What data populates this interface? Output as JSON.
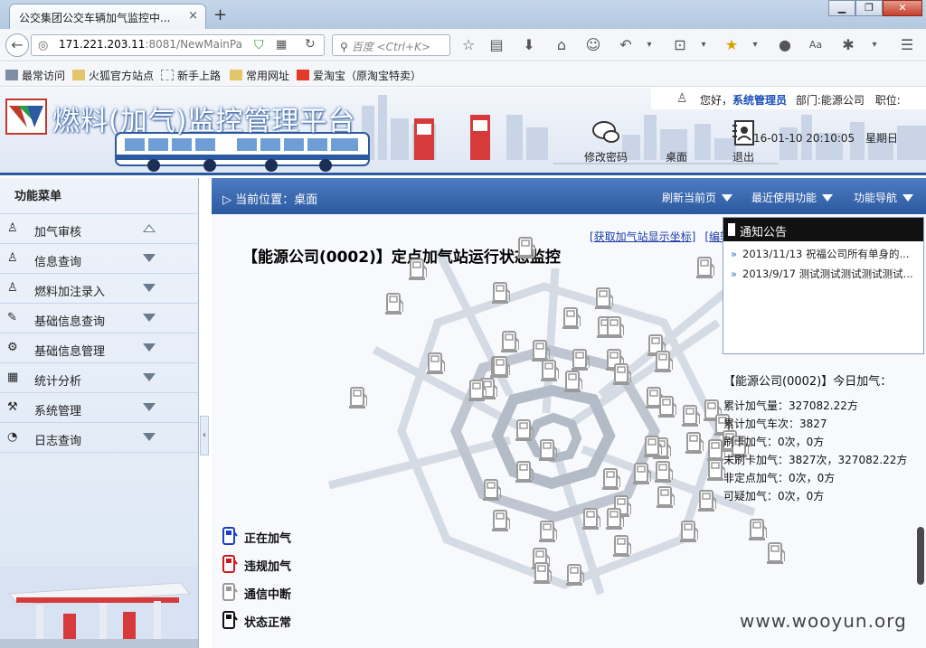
{
  "browser": {
    "tab_title": "公交集团公交车辆加气监控中...",
    "tab_close": "×",
    "new_tab": "+",
    "url_host": "171.221.203.11",
    "url_rest": ":8081/NewMainPa",
    "search_placeholder": "百度 <Ctrl+K>",
    "bookmarks": [
      "最常访问",
      "火狐官方站点",
      "新手上路",
      "常用网址",
      "爱淘宝（原淘宝特卖）"
    ]
  },
  "header": {
    "app_title": "燃料(加气)监控管理平台",
    "greeting": "您好，",
    "user_name": "系统管理员",
    "dept": "部门:能源公司",
    "position": "职位:",
    "change_password": "修改密码",
    "desktop": "桌面",
    "logout": "退出",
    "datetime": "16-01-10 20:10:05",
    "weekday": "星期日"
  },
  "sidebar": {
    "title": "功能菜单",
    "items": [
      {
        "label": "加气审核",
        "icon": "user-icon",
        "expanded": true
      },
      {
        "label": "信息查询",
        "icon": "users-icon",
        "expanded": false
      },
      {
        "label": "燃料加注录入",
        "icon": "group-icon",
        "expanded": false
      },
      {
        "label": "基础信息查询",
        "icon": "edit-icon",
        "expanded": false
      },
      {
        "label": "基础信息管理",
        "icon": "settings-icon",
        "expanded": false
      },
      {
        "label": "统计分析",
        "icon": "calendar-icon",
        "expanded": false
      },
      {
        "label": "系统管理",
        "icon": "tools-icon",
        "expanded": false
      },
      {
        "label": "日志查询",
        "icon": "rss-icon",
        "expanded": false
      }
    ],
    "collapse": "‹"
  },
  "crumb": {
    "location": "当前位置：桌面",
    "refresh": "刷新当前页",
    "recent": "最近使用功能",
    "nav": "功能导航"
  },
  "map": {
    "title": "【能源公司(0002)】定点加气站运行状态监控",
    "link_coords": "[获取加气站显示坐标]",
    "link_edit": "[编辑"
  },
  "notice": {
    "title": "通知公告",
    "items": [
      "2013/11/13 祝福公司所有单身的...",
      "2013/9/17 测试测试测试测试测试..."
    ]
  },
  "stats": {
    "title": "【能源公司(0002)】今日加气：",
    "rows": [
      "累计加气量：327082.22方",
      "累计加气车次：3827",
      "刷卡加气：0次，0方",
      "未刷卡加气：3827次，327082.22方",
      "非定点加气：0次，0方",
      "可疑加气：0次，0方"
    ]
  },
  "legend": [
    {
      "label": "正在加气",
      "color": "#1a3fd0"
    },
    {
      "label": "违规加气",
      "color": "#d01a1a"
    },
    {
      "label": "通信中断",
      "color": "#9a9a9a"
    },
    {
      "label": "状态正常",
      "color": "#111111"
    }
  ],
  "watermark": "www.wooyun.org"
}
